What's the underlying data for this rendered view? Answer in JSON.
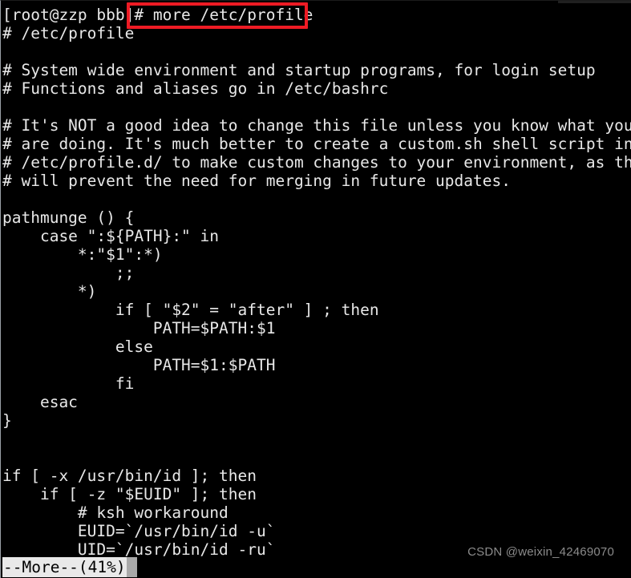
{
  "terminal": {
    "background_color": "#000000",
    "foreground_color": "#e8e8e8",
    "command_line": "[root@zzp bbb]# more /etc/profile",
    "lines": [
      "[root@zzp bbb]# more /etc/profile",
      "# /etc/profile",
      "",
      "# System wide environment and startup programs, for login setup",
      "# Functions and aliases go in /etc/bashrc",
      "",
      "# It's NOT a good idea to change this file unless you know what you",
      "# are doing. It's much better to create a custom.sh shell script in",
      "# /etc/profile.d/ to make custom changes to your environment, as this",
      "# will prevent the need for merging in future updates.",
      "",
      "pathmunge () {",
      "    case \":${PATH}:\" in",
      "        *:\"$1\":*)",
      "            ;;",
      "        *)",
      "            if [ \"$2\" = \"after\" ] ; then",
      "                PATH=$PATH:$1",
      "            else",
      "                PATH=$1:$PATH",
      "            fi",
      "    esac",
      "}",
      "",
      "",
      "if [ -x /usr/bin/id ]; then",
      "    if [ -z \"$EUID\" ]; then",
      "        # ksh workaround",
      "        EUID=`/usr/bin/id -u`",
      "        UID=`/usr/bin/id -ru`"
    ]
  },
  "highlight": {
    "color": "#ee1b24",
    "target_text": "# more /etc/profile"
  },
  "status_bar": {
    "label": "--More--(41%)",
    "percent": 41,
    "background_color": "#e9e9e9",
    "text_color": "#000000",
    "cursor_color": "#a9a9a9"
  },
  "watermark": {
    "text": "CSDN @weixin_42469070",
    "color": "#8b8b8b"
  }
}
